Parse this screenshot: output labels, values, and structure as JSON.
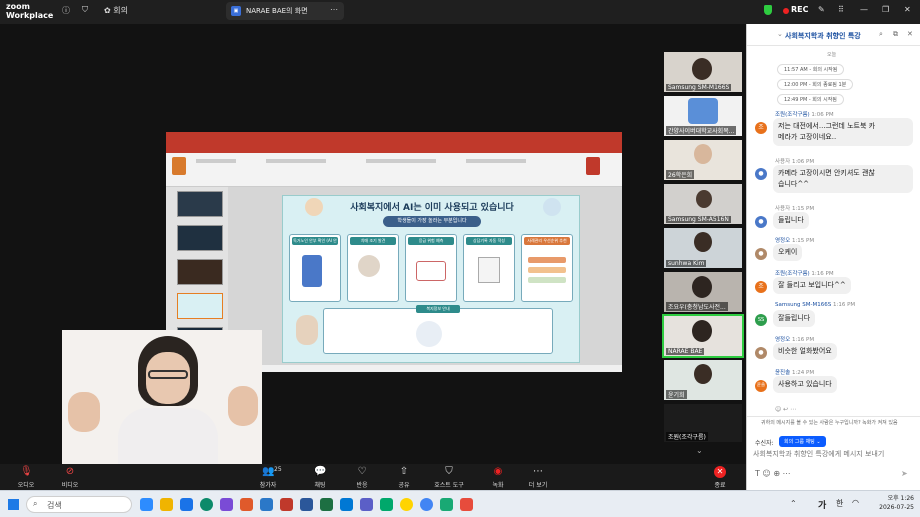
{
  "titlebar": {
    "app_name_1": "zoom",
    "app_name_2": "Workplace",
    "meeting_label": "회의",
    "share_tab_label": "NARAE BAE의 화면",
    "rec_label": "REC"
  },
  "slide": {
    "title": "사회복지에서 AI는 이미 사용되고 있습니다",
    "subtitle": "학생들이 가장 놀라는 부분입니다",
    "cards": [
      "독거노인 안부 확인 (AI 안부 전화)",
      "치매 조기 발견",
      "응급 위험 예측",
      "상담기록 자동 작성",
      "사례관리 우선순위 추천"
    ],
    "bottom_label": "복지정보 안내"
  },
  "tiles": [
    {
      "name": "Samsung SM-M166S"
    },
    {
      "name": "간양사이버대학교사회복..."
    },
    {
      "name": "26학은희"
    },
    {
      "name": "Samsung SM-A516N"
    },
    {
      "name": "sunhwa Kim"
    },
    {
      "name": "조요우(충청남도사전..."
    },
    {
      "name": "NARAE BAE"
    },
    {
      "name": "윤기희"
    },
    {
      "name": "조원(조각구름)"
    }
  ],
  "chat": {
    "title": "사회복지학과 취향인 특강",
    "date_label": "오늘",
    "system": [
      "11:57 AM - 회의 시작됨",
      "12:00 PM - 회의 종료됨 1분",
      "12:49 PM - 회의 시작됨"
    ],
    "messages": [
      {
        "sender": "조원(조각구름)",
        "time": "1:06 PM",
        "avatar": "조",
        "avatar_color": "#e8711b",
        "text_1": "저는 대전에서...그런데 노트북 카",
        "text_2": "메라가 고장이네요.."
      },
      {
        "sender": "사용자",
        "time": "1:06 PM",
        "avatar": "",
        "avatar_color": "#4a78c8",
        "text_1": "카메라 고장이시면 안키셔도 괜찮",
        "text_2": "습니다^^"
      },
      {
        "sender": "사용자",
        "time": "1:15 PM",
        "avatar": "",
        "avatar_color": "#4a78c8",
        "text_1": "들립니다",
        "text_2": ""
      },
      {
        "sender": "영정오",
        "time": "1:15 PM",
        "avatar": "",
        "avatar_color": "#b08968",
        "text_1": "오케이",
        "text_2": ""
      },
      {
        "sender": "조원(조각구름)",
        "time": "1:16 PM",
        "avatar": "조",
        "avatar_color": "#e8711b",
        "text_1": "잘 들리고 보입니다^^",
        "text_2": ""
      },
      {
        "sender": "Samsung SM-M166S",
        "time": "1:16 PM",
        "avatar": "SS",
        "avatar_color": "#2e9e4d",
        "text_1": "잘들립니다",
        "text_2": ""
      },
      {
        "sender": "영정오",
        "time": "1:16 PM",
        "avatar": "",
        "avatar_color": "#b08968",
        "text_1": "비슷한 얼화봤어요",
        "text_2": ""
      },
      {
        "sender": "윤진솔",
        "time": "1:24 PM",
        "avatar": "윤솔",
        "avatar_color": "#e8711b",
        "text_1": "사용하고 있습니다",
        "text_2": ""
      }
    ],
    "note": "귀하의 메시지를 볼 수 있는 사람은 누구입니까? 녹화가 켜져 있음",
    "recipient_label": "수신자:",
    "recipient_value": "회의 그룹 채팅",
    "input_placeholder": "사회복지학과 취향인 특강에게 메시지 보내기"
  },
  "toolbar": {
    "audio": "오디오",
    "video": "비디오",
    "participants": "참가자",
    "participants_count": "25",
    "chat": "채팅",
    "reactions": "반응",
    "share": "공유",
    "host_tools": "호스트 도구",
    "record": "녹화",
    "more": "더 보기",
    "end": "종료"
  },
  "taskbar": {
    "search_placeholder": "검색",
    "time": "오후 1:26",
    "date": "2026-07-25",
    "lang": "가",
    "ime": "한"
  },
  "colors": {
    "zoom_blue": "#0b5cff",
    "ppt_red": "#c0392b",
    "record_red": "#e22222",
    "active_green": "#2ecc40"
  }
}
